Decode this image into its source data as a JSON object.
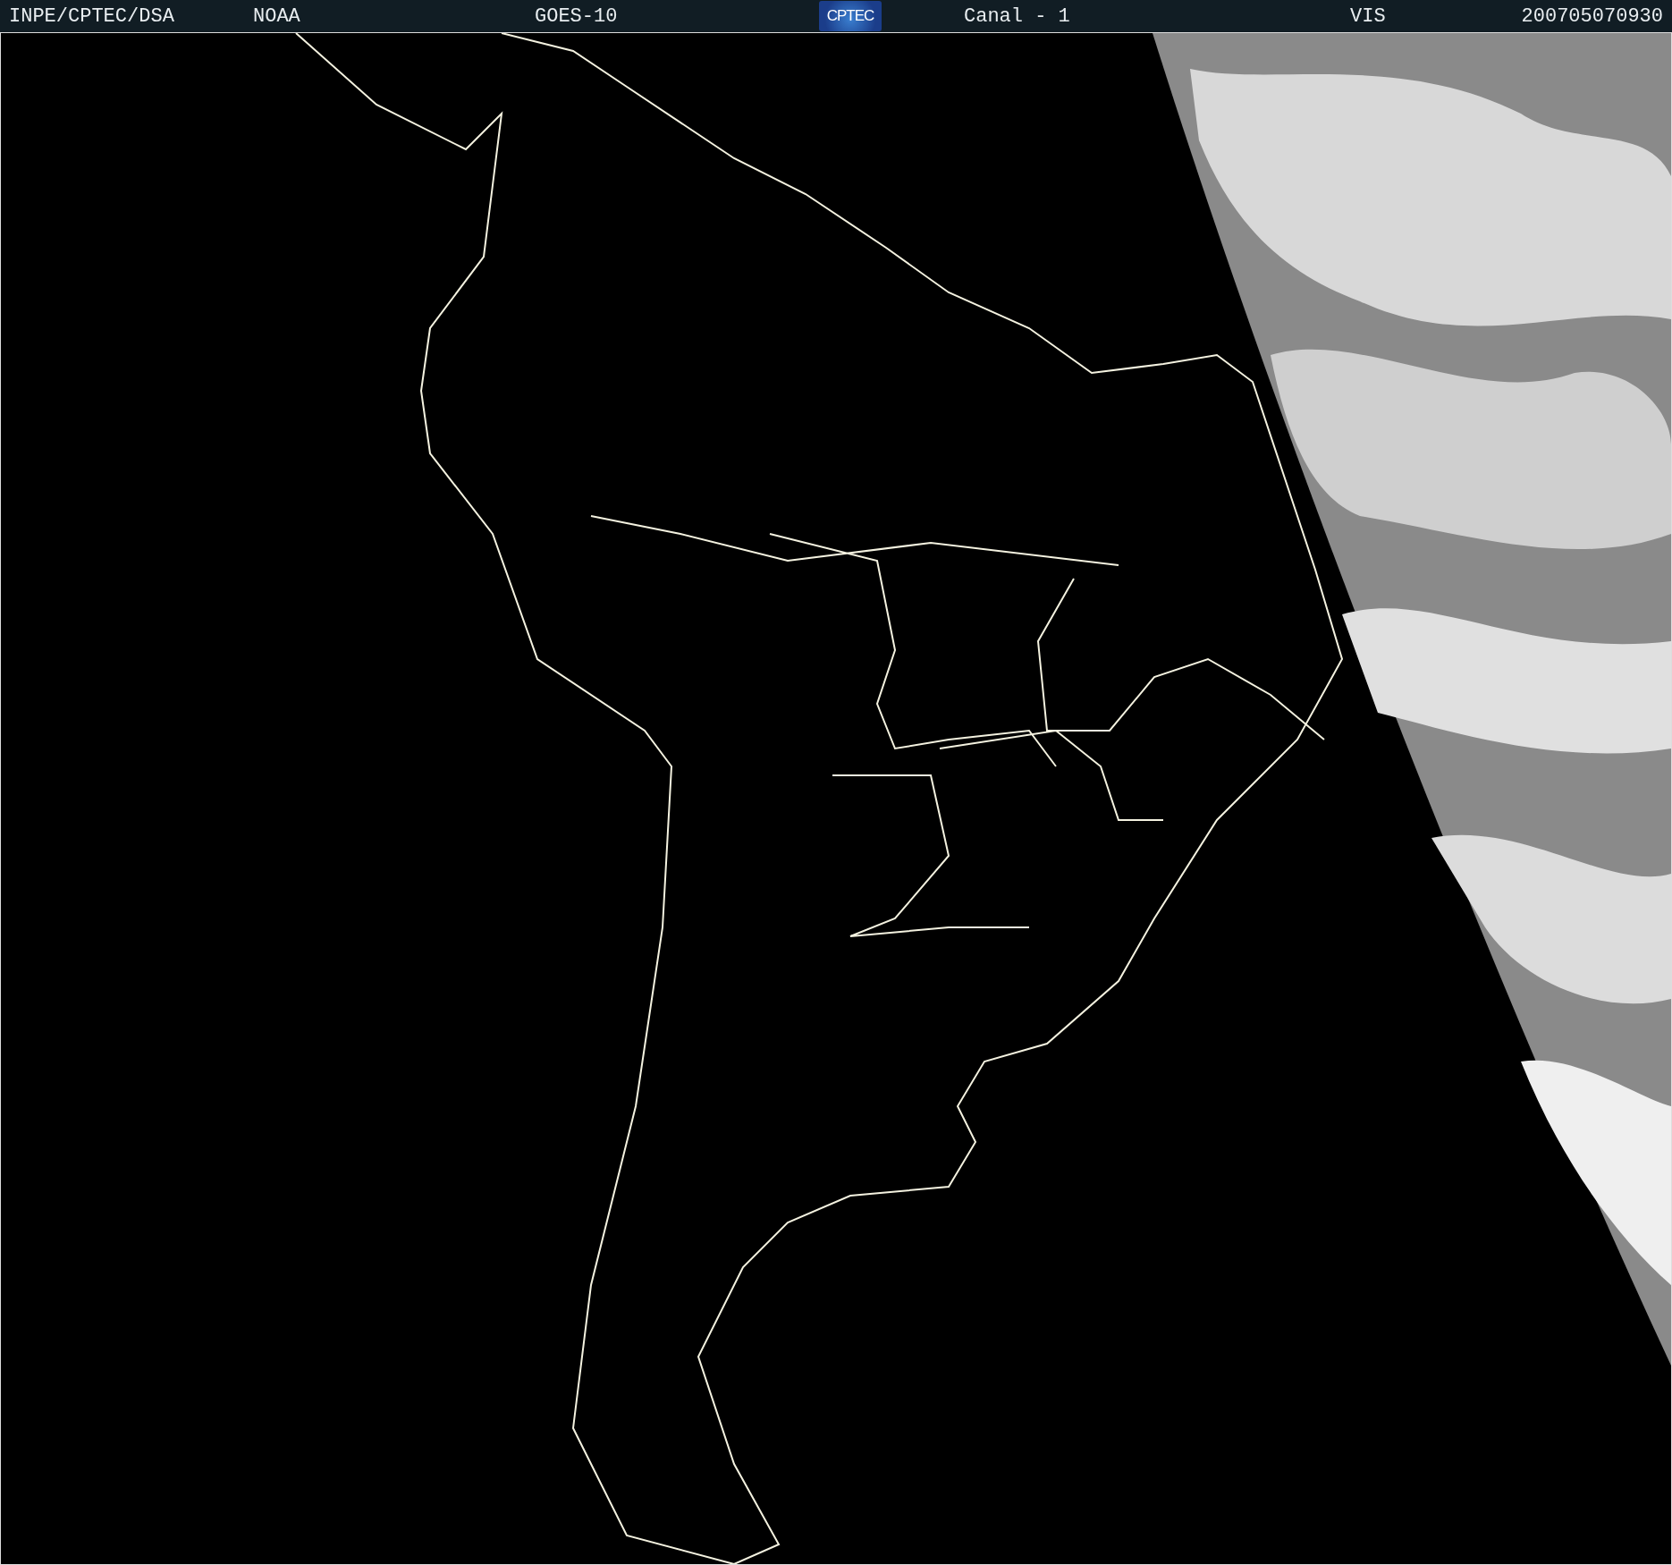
{
  "header": {
    "items": [
      {
        "kind": "text",
        "text": "INPE/CPTEC/DSA"
      },
      {
        "kind": "text",
        "text": "NOAA"
      },
      {
        "kind": "text",
        "text": "GOES-10"
      },
      {
        "kind": "logo",
        "text": "CPTEC"
      },
      {
        "kind": "text",
        "text": "Canal - 1"
      },
      {
        "kind": "text",
        "text": "VIS"
      },
      {
        "kind": "text",
        "text": "200705070930"
      }
    ]
  }
}
